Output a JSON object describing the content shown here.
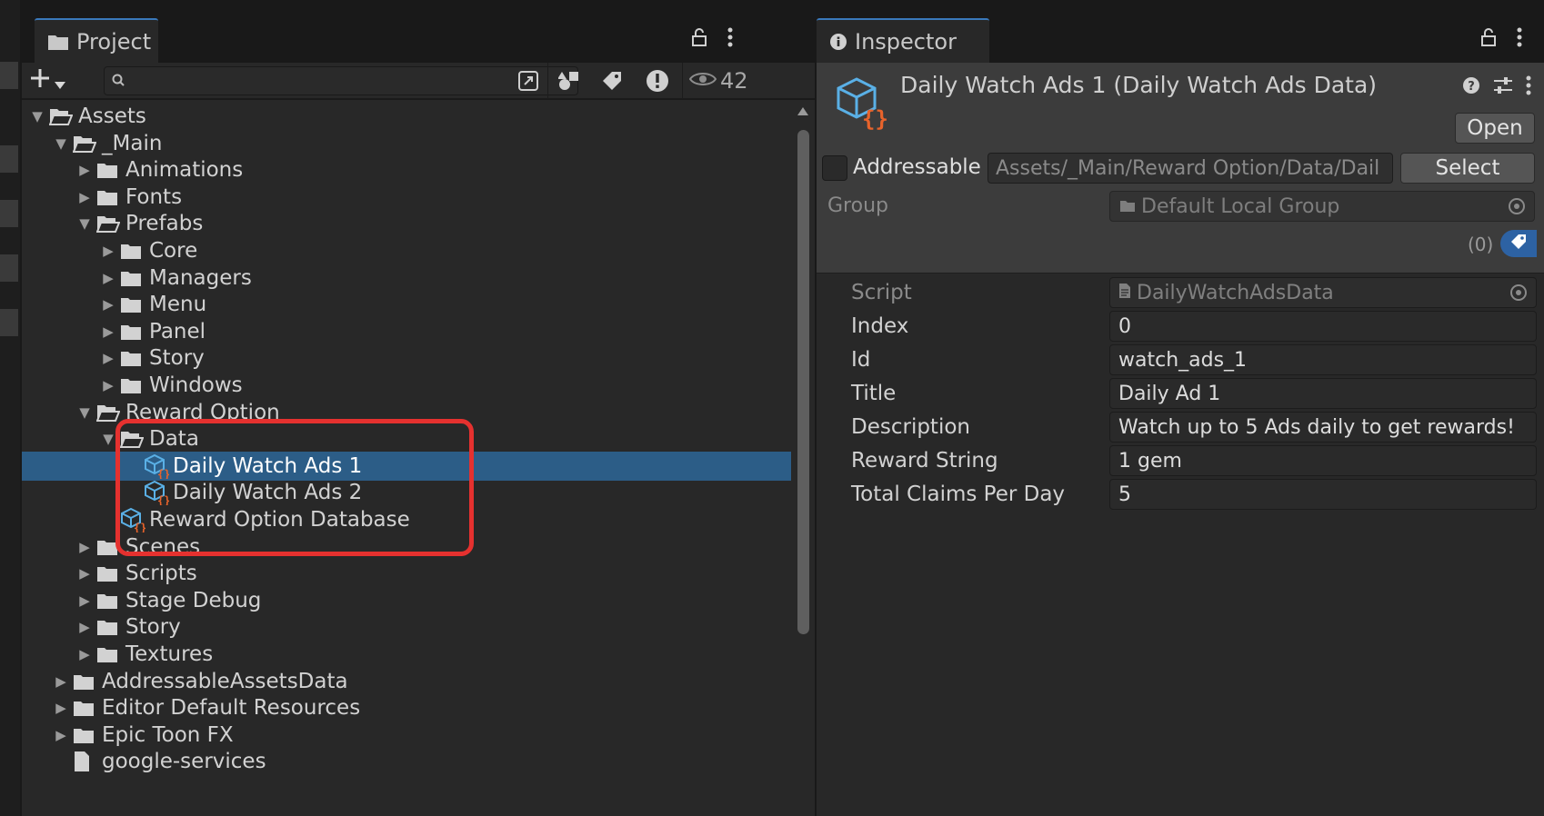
{
  "project": {
    "tab_label": "Project",
    "search": {
      "value": "",
      "placeholder": ""
    },
    "hidden_count": "42",
    "tree": [
      {
        "label": "Assets",
        "depth": 0,
        "arrow": "open",
        "icon": "folder-open"
      },
      {
        "label": "_Main",
        "depth": 1,
        "arrow": "open",
        "icon": "folder-open"
      },
      {
        "label": "Animations",
        "depth": 2,
        "arrow": "closed",
        "icon": "folder"
      },
      {
        "label": "Fonts",
        "depth": 2,
        "arrow": "closed",
        "icon": "folder"
      },
      {
        "label": "Prefabs",
        "depth": 2,
        "arrow": "open",
        "icon": "folder-open"
      },
      {
        "label": "Core",
        "depth": 3,
        "arrow": "closed",
        "icon": "folder"
      },
      {
        "label": "Managers",
        "depth": 3,
        "arrow": "closed",
        "icon": "folder"
      },
      {
        "label": "Menu",
        "depth": 3,
        "arrow": "closed",
        "icon": "folder"
      },
      {
        "label": "Panel",
        "depth": 3,
        "arrow": "closed",
        "icon": "folder"
      },
      {
        "label": "Story",
        "depth": 3,
        "arrow": "closed",
        "icon": "folder"
      },
      {
        "label": "Windows",
        "depth": 3,
        "arrow": "closed",
        "icon": "folder"
      },
      {
        "label": "Reward Option",
        "depth": 2,
        "arrow": "open",
        "icon": "folder-open"
      },
      {
        "label": "Data",
        "depth": 3,
        "arrow": "open",
        "icon": "folder-open"
      },
      {
        "label": "Daily Watch Ads 1",
        "depth": 4,
        "arrow": "none",
        "icon": "asset",
        "selected": true
      },
      {
        "label": "Daily Watch Ads 2",
        "depth": 4,
        "arrow": "none",
        "icon": "asset"
      },
      {
        "label": "Reward Option Database",
        "depth": 3,
        "arrow": "none",
        "icon": "asset"
      },
      {
        "label": "Scenes",
        "depth": 2,
        "arrow": "closed",
        "icon": "folder"
      },
      {
        "label": "Scripts",
        "depth": 2,
        "arrow": "closed",
        "icon": "folder"
      },
      {
        "label": "Stage Debug",
        "depth": 2,
        "arrow": "closed",
        "icon": "folder"
      },
      {
        "label": "Story",
        "depth": 2,
        "arrow": "closed",
        "icon": "folder"
      },
      {
        "label": "Textures",
        "depth": 2,
        "arrow": "closed",
        "icon": "folder"
      },
      {
        "label": "AddressableAssetsData",
        "depth": 1,
        "arrow": "closed",
        "icon": "folder"
      },
      {
        "label": "Editor Default Resources",
        "depth": 1,
        "arrow": "closed",
        "icon": "folder"
      },
      {
        "label": "Epic Toon FX",
        "depth": 1,
        "arrow": "closed",
        "icon": "folder"
      },
      {
        "label": "google-services",
        "depth": 1,
        "arrow": "none",
        "icon": "file"
      }
    ]
  },
  "inspector": {
    "tab_label": "Inspector",
    "title": "Daily Watch Ads 1 (Daily Watch Ads Data)",
    "open_label": "Open",
    "addressable_label": "Addressable",
    "addressable_checked": false,
    "address_path": "Assets/_Main/Reward Option/Data/Dail",
    "select_label": "Select",
    "group_label": "Group",
    "group_value": "Default Local Group",
    "labels_count": "(0)",
    "properties": [
      {
        "label": "Script",
        "value": "DailyWatchAdsData",
        "readonly": true
      },
      {
        "label": "Index",
        "value": "0"
      },
      {
        "label": "Id",
        "value": "watch_ads_1"
      },
      {
        "label": "Title",
        "value": "Daily Ad 1"
      },
      {
        "label": "Description",
        "value": "Watch up to 5 Ads daily to get rewards!"
      },
      {
        "label": "Reward String",
        "value": "1 gem"
      },
      {
        "label": "Total Claims Per Day",
        "value": "5"
      }
    ]
  },
  "colors": {
    "selection": "#2c5d87",
    "highlight_box": "#e5312f",
    "asset_icon_blue": "#5ab0e6",
    "asset_icon_orange": "#e8632b",
    "tab_accent": "#3a79bb"
  }
}
